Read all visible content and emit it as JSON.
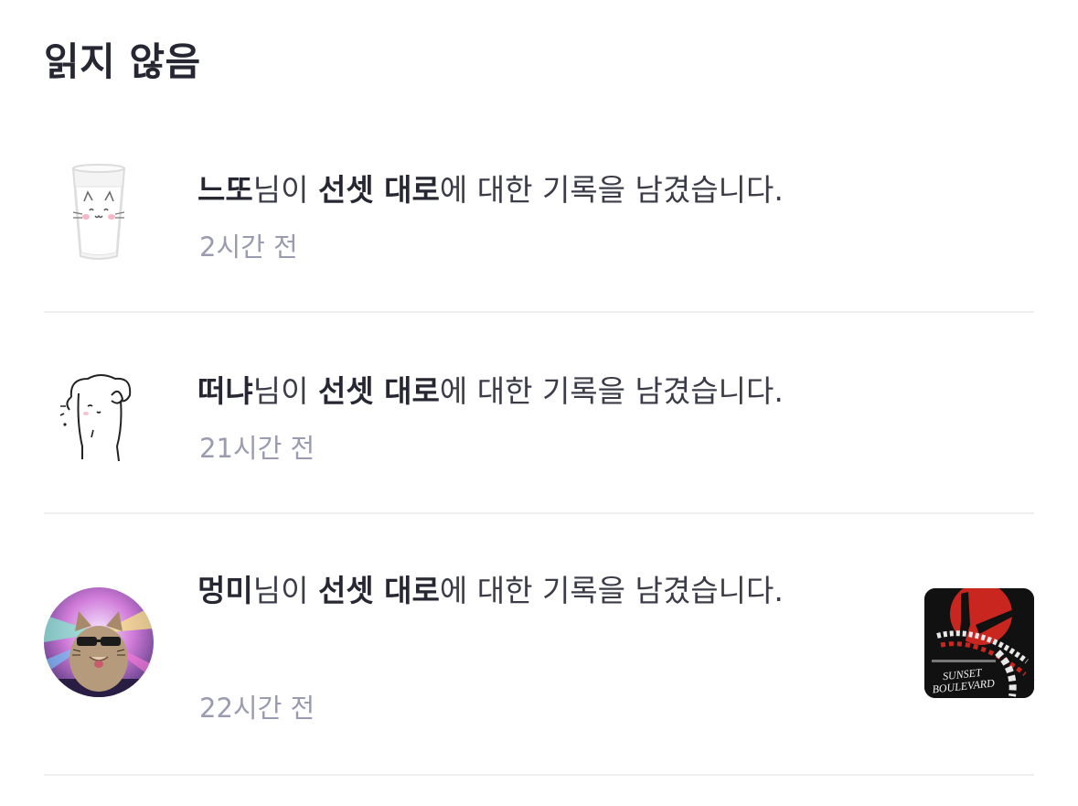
{
  "header": {
    "title": "읽지 않음"
  },
  "notifications": [
    {
      "user": "느또",
      "suffix_user": "님이 ",
      "movie": "선셋 대로",
      "suffix_text": "에 대한 기록을 남겼습니다.",
      "time": "2시간 전",
      "avatar_icon": "milk-cat-avatar-icon"
    },
    {
      "user": "떠냐",
      "suffix_user": "님이 ",
      "movie": "선셋 대로",
      "suffix_text": "에 대한 기록을 남겼습니다.",
      "time": "21시간 전",
      "avatar_icon": "doodle-dog-avatar-icon"
    },
    {
      "user": "멍미",
      "suffix_user": "님이 ",
      "movie": "선셋 대로",
      "suffix_text": "에 대한 기록을 남겼습니다.",
      "time": "22시간 전",
      "avatar_icon": "sunglasses-cat-avatar-icon",
      "thumbnail": {
        "icon": "movie-poster-thumbnail",
        "caption_lines": [
          "SUNSET",
          "BOULEVARD"
        ]
      }
    }
  ],
  "colors": {
    "title": "#262733",
    "text": "#3b3c48",
    "time": "#9a9bb0",
    "divider": "#eeeef1",
    "poster_red": "#c8261f",
    "poster_black": "#111111"
  }
}
